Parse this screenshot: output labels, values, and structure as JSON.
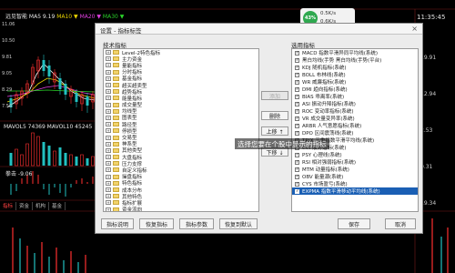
{
  "chart": {
    "title": "远见智能 MA5 9.19",
    "ma5": "MA5 ▼",
    "ma10": "MA10 ▼",
    "ma20": "MA20 ▼",
    "ma30": "MA30 ▼",
    "price_labels": [
      "11.06",
      "10.50",
      "9.81",
      "9.05",
      "8.29",
      "7.58"
    ],
    "mavol": "MAVOL5 74369  MAVOL10 45245",
    "sub_label": "拳击 -9.06",
    "bottom_tabs": [
      "指标",
      "资金",
      "机构",
      "基金"
    ],
    "right_labels": [
      "19.91",
      "12.94",
      "2.53",
      "0.31",
      "19.34"
    ],
    "clock": "11:35:45",
    "colors": {
      "up": "#ff3030",
      "down": "#22c0c0",
      "ma10": "#e6d200",
      "ma20": "#e040e0",
      "ma30": "#2ad22a"
    }
  },
  "ad_widget": {
    "badge": "43%",
    "line1": "0.5K/s",
    "line2": "0.6K/s"
  },
  "dialog": {
    "title": "设置 - 指标标签",
    "close": "×",
    "left_label": "技术指标",
    "right_label": "选用指标",
    "left_items": [
      "Level-2特色指标",
      "主力资金",
      "量能指标",
      "分时指标",
      "基金指标",
      "超买超卖型",
      "趋势指标",
      "能量指标",
      "成交量型",
      "均线型",
      "图表型",
      "路径型",
      "停损型",
      "交易型",
      "神系型",
      "其他类型",
      "大盘指标",
      "压力支撑",
      "自定义指标",
      "操盘指标",
      "特色指标",
      "成本分布",
      "其他特色",
      "指标扩展",
      "资金流向",
      "短线精灵",
      "自编指标",
      "常用指标",
      "买卖指标",
      "系统指标",
      "未分类"
    ],
    "right_items": [
      "MACD 指数平滑异同平均线(系统)",
      "黑白均线(手势 黑白均线(手势(平台)",
      "KDJ 随机指标(系统)",
      "BOLL 布林线(系统)",
      "WR 威廉指标(系统)",
      "DMI 趋向指标(系统)",
      "BIAS 乖离率(系统)",
      "ASI 振动升降指标(系统)",
      "ROC 变动率指标(系统)",
      "VR 成交量变异率(系统)",
      "ARBR 人气意愿指标(系统)",
      "DPO 区间震荡线(系统)",
      "TRIX 三重指数平滑平均线(系统)",
      "CCI 顺势指标(系统)",
      "PSY 心理线(系统)",
      "RSI 相对强弱指标(系统)",
      "MTM 动量指标(系统)",
      "OBV 能量潮(系统)",
      "CYS 市场盈亏(系统)",
      "EXPMA 指数平滑移动平均线(系统)"
    ],
    "right_selected_index": 19,
    "mid_buttons": {
      "add": "添加",
      "remove": "删除",
      "up": "上移 ↑",
      "down": "下移 ↓"
    },
    "bottom_buttons": {
      "desc": "指标说明",
      "restore": "恢复指标",
      "set": "指标参数",
      "default": "恢复到默认",
      "save": "保存",
      "cancel": "取消"
    }
  },
  "overlay_message": "选择您要在个股中显示的指标"
}
